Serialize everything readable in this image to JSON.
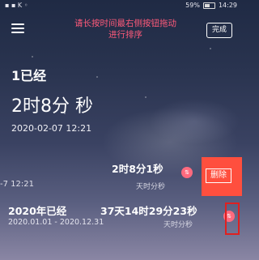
{
  "status": {
    "time": "14:29",
    "battery": "59%",
    "left": "▪ ▪ K ◦"
  },
  "hint": "请长按时间最右侧按钮拖动进行排序",
  "done_label": "完成",
  "main": {
    "title": "1已经",
    "duration": "2时8分 秒",
    "date": "2020-02-07 12:21"
  },
  "row1": {
    "duration": "2时8分1秒",
    "date": "-7 12:21",
    "unit": "天时分秒",
    "sort_icon": "⇅",
    "delete_label": "删除"
  },
  "row2": {
    "title": "2020年已经",
    "duration": "37天14时29分23秒",
    "date": "2020.01.01 - 2020.12.31",
    "unit": "天时分秒",
    "sort_icon": "⇅"
  },
  "colors": {
    "hint": "#ff5a7a",
    "delete_bg": "#ff4f3e",
    "sort_btn": "#ff6a7e"
  }
}
